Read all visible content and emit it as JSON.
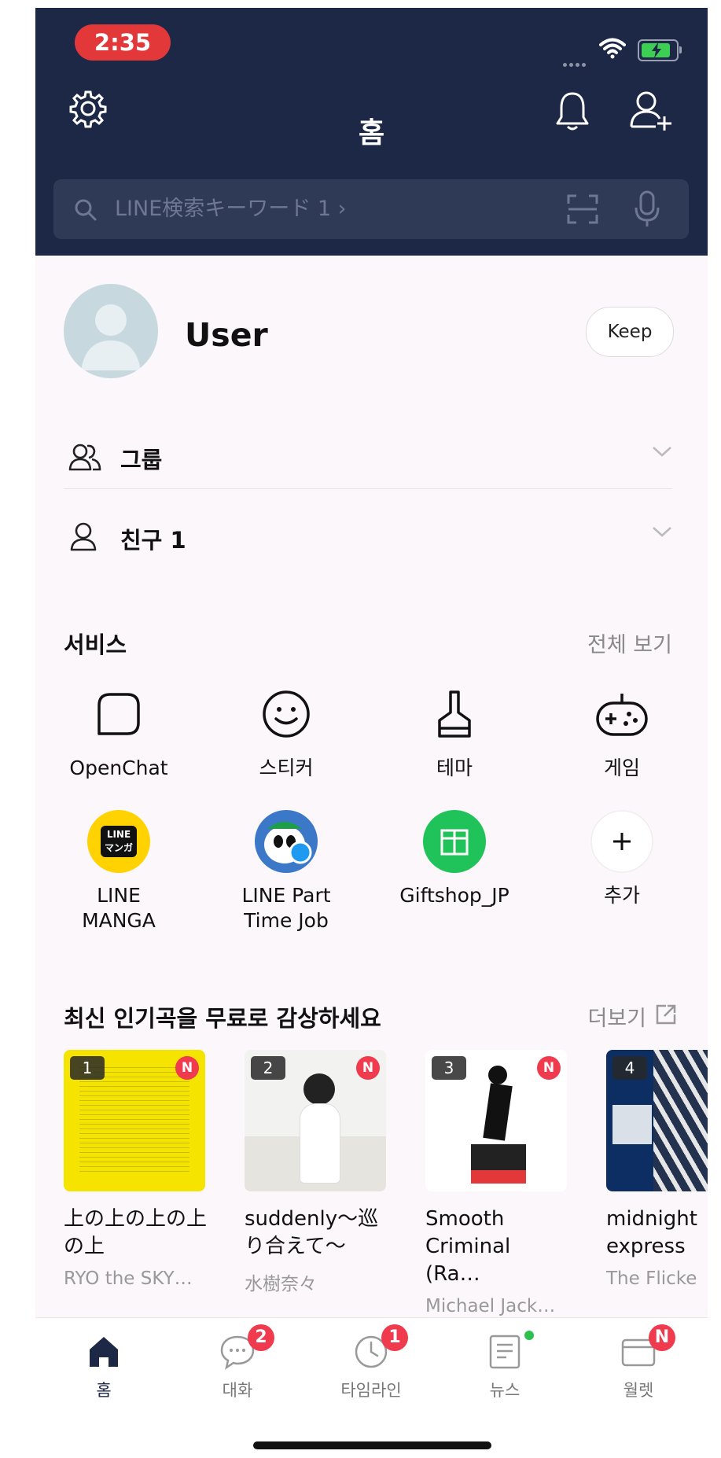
{
  "status_bar": {
    "time": "2:35"
  },
  "header": {
    "title": "홈"
  },
  "search": {
    "placeholder": "LINE検索キーワード 1 ›"
  },
  "profile": {
    "name": "User",
    "keep_label": "Keep"
  },
  "lists": {
    "groups_label": "그룹",
    "friends_label": "친구 1"
  },
  "services": {
    "title": "서비스",
    "see_all": "전체 보기",
    "items": [
      {
        "label": "OpenChat",
        "icon": "openchat-icon"
      },
      {
        "label": "스티커",
        "icon": "sticker-icon"
      },
      {
        "label": "테마",
        "icon": "theme-brush-icon"
      },
      {
        "label": "게임",
        "icon": "game-controller-icon"
      },
      {
        "label": "LINE\nMANGA",
        "icon": "line-manga-icon",
        "icon_text": "LINE\nマンガ"
      },
      {
        "label": "LINE Part\nTime Job",
        "icon": "line-part-time-job-icon"
      },
      {
        "label": "Giftshop_JP",
        "icon": "giftshop-icon"
      },
      {
        "label": "추가",
        "icon": "add-icon"
      }
    ]
  },
  "music": {
    "title": "최신 인기곡을 무료로 감상하세요",
    "more": "더보기",
    "items": [
      {
        "rank": "1",
        "badge": "N",
        "title": "上の上の上の上\nの上",
        "artist": "RYO the SKY…"
      },
      {
        "rank": "2",
        "badge": "N",
        "title": "suddenly～巡\nり合えて～",
        "artist": "水樹奈々"
      },
      {
        "rank": "3",
        "badge": "N",
        "title": "Smooth\nCriminal (Ra…",
        "artist": "Michael Jack…"
      },
      {
        "rank": "4",
        "badge": "N",
        "title": "midnight\nexpress",
        "artist": "The Flicke"
      }
    ]
  },
  "tabs": [
    {
      "label": "홈",
      "icon": "home-icon",
      "active": true
    },
    {
      "label": "대화",
      "icon": "chat-icon",
      "badge": "2"
    },
    {
      "label": "타임라인",
      "icon": "timeline-clock-icon",
      "badge": "1"
    },
    {
      "label": "뉴스",
      "icon": "news-icon",
      "dot": true
    },
    {
      "label": "월렛",
      "icon": "wallet-icon",
      "badge": "N"
    }
  ],
  "colors": {
    "header_bg": "#1d2847",
    "badge": "#f03a4e",
    "gift_green": "#20c25a",
    "manga_yellow": "#ffd200"
  }
}
